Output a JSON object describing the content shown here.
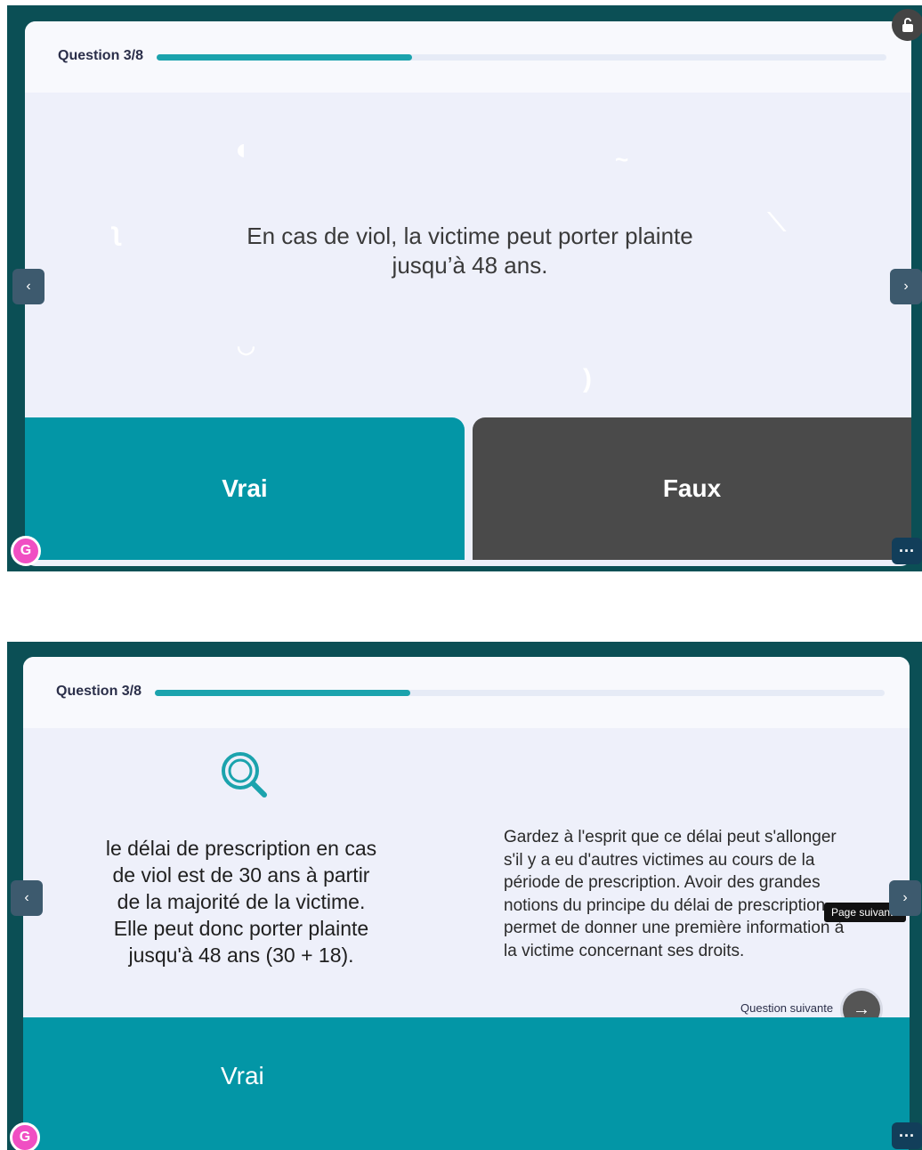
{
  "colors": {
    "frame": "#0b4f55",
    "accent": "#0396a6",
    "false_button": "#4a4a4a",
    "badge": "#f04fc3"
  },
  "screen1": {
    "question_label": "Question 3/8",
    "progress": 0.35,
    "question_line1": "En cas de viol, la victime peut porter plainte",
    "question_line2": "jusqu’à 48 ans.",
    "answer_true": "Vrai",
    "answer_false": "Faux",
    "prev_icon": "‹",
    "next_icon": "›",
    "more_icon": "···",
    "lock_icon": "lock-icon",
    "badge_icon": "G"
  },
  "screen2": {
    "question_label": "Question 3/8",
    "progress": 0.35,
    "search_icon": "magnifier-icon",
    "explanation_lines": [
      "le délai de prescription en cas",
      "de viol est de 30 ans à partir",
      "de la majorité de la victime.",
      "Elle peut donc porter plainte",
      "jusqu'à 48 ans (30 + 18)."
    ],
    "aside_lines": [
      "Gardez à l'esprit que ce délai peut s'allonger",
      "s'il y a eu d'autres victimes au cours de la",
      "période de prescription. Avoir des grandes",
      "notions du principe du délai de prescription",
      "permet de donner une première information à",
      "la victime concernant ses droits."
    ],
    "tooltip": "Page suivante",
    "next_question_label": "Question suivante",
    "next_question_icon": "→",
    "answer_true": "Vrai",
    "prev_icon": "‹",
    "next_icon": "›",
    "more_icon": "···",
    "badge_icon": "G"
  }
}
